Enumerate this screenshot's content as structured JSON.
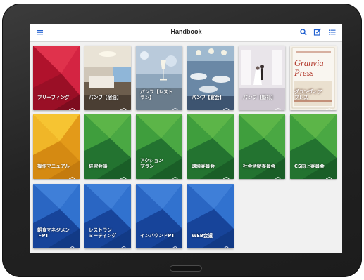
{
  "header": {
    "title": "Handbook",
    "menu_icon": "menu-icon",
    "search_icon": "search-icon",
    "edit_icon": "edit-icon",
    "list_icon": "list-icon",
    "accent_color": "#1f5fd0"
  },
  "tiles": [
    {
      "label": "ブリーフィング",
      "theme": "red"
    },
    {
      "label": "パンフ【宿泊】",
      "theme": "photo-room"
    },
    {
      "label": "パンフ【レスト\nラン】",
      "theme": "photo-glass"
    },
    {
      "label": "パンフ【宴会】",
      "theme": "photo-banquet"
    },
    {
      "label": "パンフ【婚礼】",
      "theme": "photo-wedding"
    },
    {
      "label": "グランヴィア\nプレス",
      "theme": "press",
      "cover_title": "Granvia\nPress"
    },
    {
      "label": "操作マニュアル",
      "theme": "yellow"
    },
    {
      "label": "経営会議",
      "theme": "green"
    },
    {
      "label": "アクション\nプラン",
      "theme": "green"
    },
    {
      "label": "環境委員会",
      "theme": "green"
    },
    {
      "label": "社会活動委員会",
      "theme": "green"
    },
    {
      "label": "CS向上委員会",
      "theme": "green"
    },
    {
      "label": "朝食マネジメン\nトPT",
      "theme": "blue"
    },
    {
      "label": "レストラン\nミーティング",
      "theme": "blue"
    },
    {
      "label": "インバウンドPT",
      "theme": "blue"
    },
    {
      "label": "WEB会議",
      "theme": "blue"
    }
  ]
}
